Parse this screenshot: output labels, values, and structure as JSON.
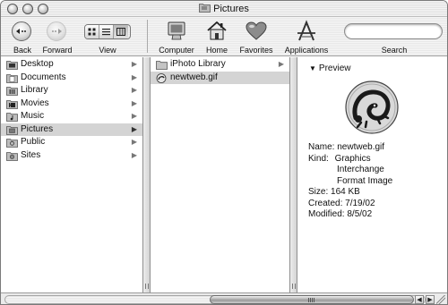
{
  "window": {
    "title": "Pictures"
  },
  "toolbar": {
    "back_label": "Back",
    "forward_label": "Forward",
    "view_label": "View",
    "computer_label": "Computer",
    "home_label": "Home",
    "favorites_label": "Favorites",
    "applications_label": "Applications",
    "search_label": "Search",
    "search_value": ""
  },
  "sidebar": {
    "items": [
      {
        "label": "Desktop",
        "icon": "desktop-folder-icon"
      },
      {
        "label": "Documents",
        "icon": "documents-folder-icon"
      },
      {
        "label": "Library",
        "icon": "library-folder-icon"
      },
      {
        "label": "Movies",
        "icon": "movies-folder-icon"
      },
      {
        "label": "Music",
        "icon": "music-folder-icon"
      },
      {
        "label": "Pictures",
        "icon": "pictures-folder-icon",
        "selected": true
      },
      {
        "label": "Public",
        "icon": "public-folder-icon"
      },
      {
        "label": "Sites",
        "icon": "sites-folder-icon"
      }
    ]
  },
  "pictures_column": {
    "items": [
      {
        "label": "iPhoto Library",
        "icon": "folder-icon"
      },
      {
        "label": "newtweb.gif",
        "icon": "gif-file-icon",
        "selected": true
      }
    ]
  },
  "preview": {
    "heading": "Preview",
    "name_label": "Name:",
    "name_value": "newtweb.gif",
    "kind_label": "Kind:",
    "kind_line1": "Graphics",
    "kind_line2": "Interchange",
    "kind_line3": "Format Image",
    "size_label": "Size:",
    "size_value": "164 KB",
    "created_label": "Created:",
    "created_value": "7/19/02",
    "modified_label": "Modified:",
    "modified_value": "8/5/02"
  },
  "colors": {
    "selection": "#d4d4d4",
    "border": "#8f8f8f"
  }
}
